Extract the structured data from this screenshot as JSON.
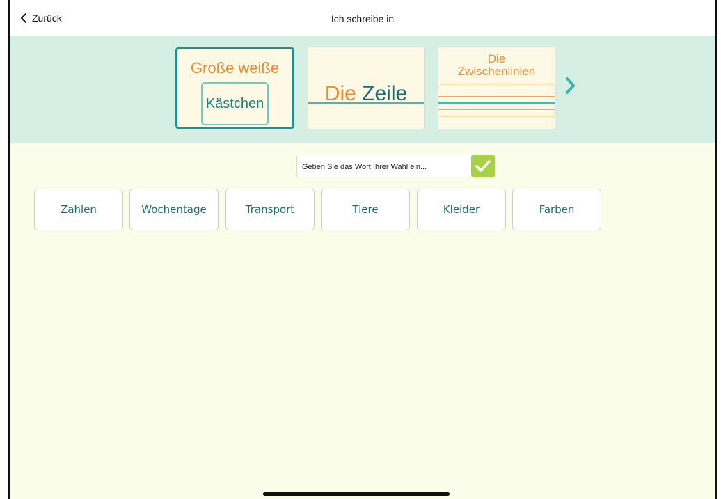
{
  "nav": {
    "back_label": "Zurück",
    "title": "Ich schreibe in"
  },
  "modes": [
    {
      "line1": "Große weiße",
      "line2": "Kästchen",
      "selected": true
    },
    {
      "word1": "Die",
      "word2": "Zeile"
    },
    {
      "line1": "Die",
      "line2": "Zwischenlinien"
    }
  ],
  "search": {
    "placeholder": "Geben Sie das Wort Ihrer Wahl ein..."
  },
  "categories": [
    "Zahlen",
    "Wochentage",
    "Transport",
    "Tiere",
    "Kleider",
    "Farben"
  ],
  "colors": {
    "accent_teal": "#1f8f8a",
    "orange": "#ee8a2f",
    "band_bg": "#d5efe4",
    "page_bg": "#fbfdeb",
    "confirm_green": "#a8d145"
  }
}
